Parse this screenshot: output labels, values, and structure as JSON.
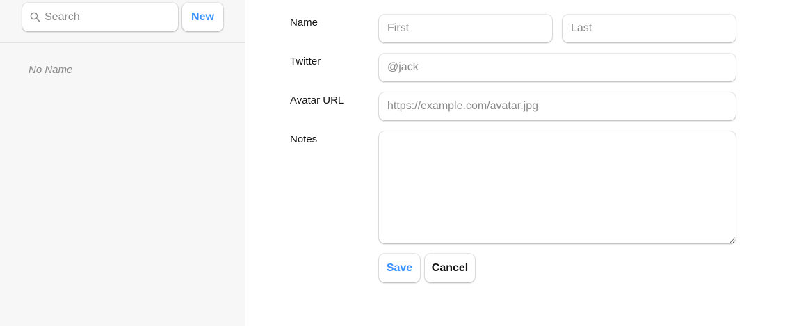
{
  "sidebar": {
    "search": {
      "placeholder": "Search",
      "icon": "search-icon"
    },
    "new_button_label": "New",
    "contacts": [
      {
        "label": "No Name"
      }
    ]
  },
  "form": {
    "name": {
      "label": "Name",
      "first_placeholder": "First",
      "last_placeholder": "Last"
    },
    "twitter": {
      "label": "Twitter",
      "placeholder": "@jack"
    },
    "avatar": {
      "label": "Avatar URL",
      "placeholder": "https://example.com/avatar.jpg"
    },
    "notes": {
      "label": "Notes"
    },
    "save_label": "Save",
    "cancel_label": "Cancel"
  },
  "colors": {
    "accent": "#3992ff",
    "sidebar_bg": "#f7f7f7",
    "border": "#e3e3e3"
  }
}
